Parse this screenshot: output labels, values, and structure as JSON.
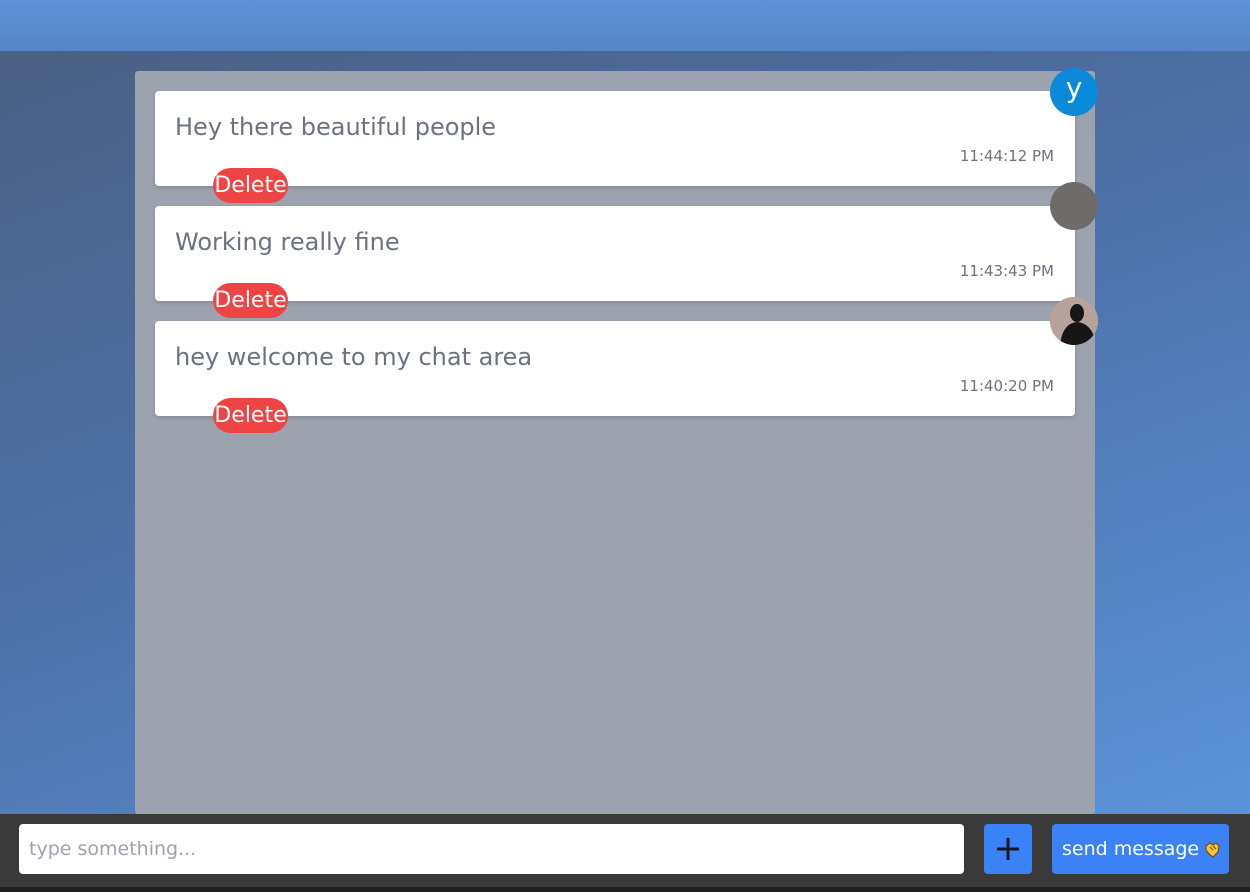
{
  "messages": [
    {
      "text": "Hey there beautiful people",
      "time": "11:44:12 PM",
      "delete_label": "Delete"
    },
    {
      "text": "Working really fine",
      "time": "11:43:43 PM",
      "delete_label": "Delete"
    },
    {
      "text": "hey welcome to my chat area",
      "time": "11:40:20 PM",
      "delete_label": "Delete"
    }
  ],
  "avatars": [
    {
      "letter": "y",
      "icon": "letter-avatar",
      "color": "#0b8ad9"
    },
    {
      "letter": "",
      "icon": "gray-avatar",
      "color": "#6e6b68"
    },
    {
      "letter": "",
      "icon": "photo-avatar",
      "color": "#b59c94"
    }
  ],
  "composer": {
    "placeholder": "type something...",
    "value": "",
    "add_icon": "plus-icon",
    "send_label": "send message",
    "send_icon": "hand-icon"
  },
  "colors": {
    "accent": "#3b82f6",
    "delete": "#ef4444",
    "panel": "#9ca3af"
  }
}
